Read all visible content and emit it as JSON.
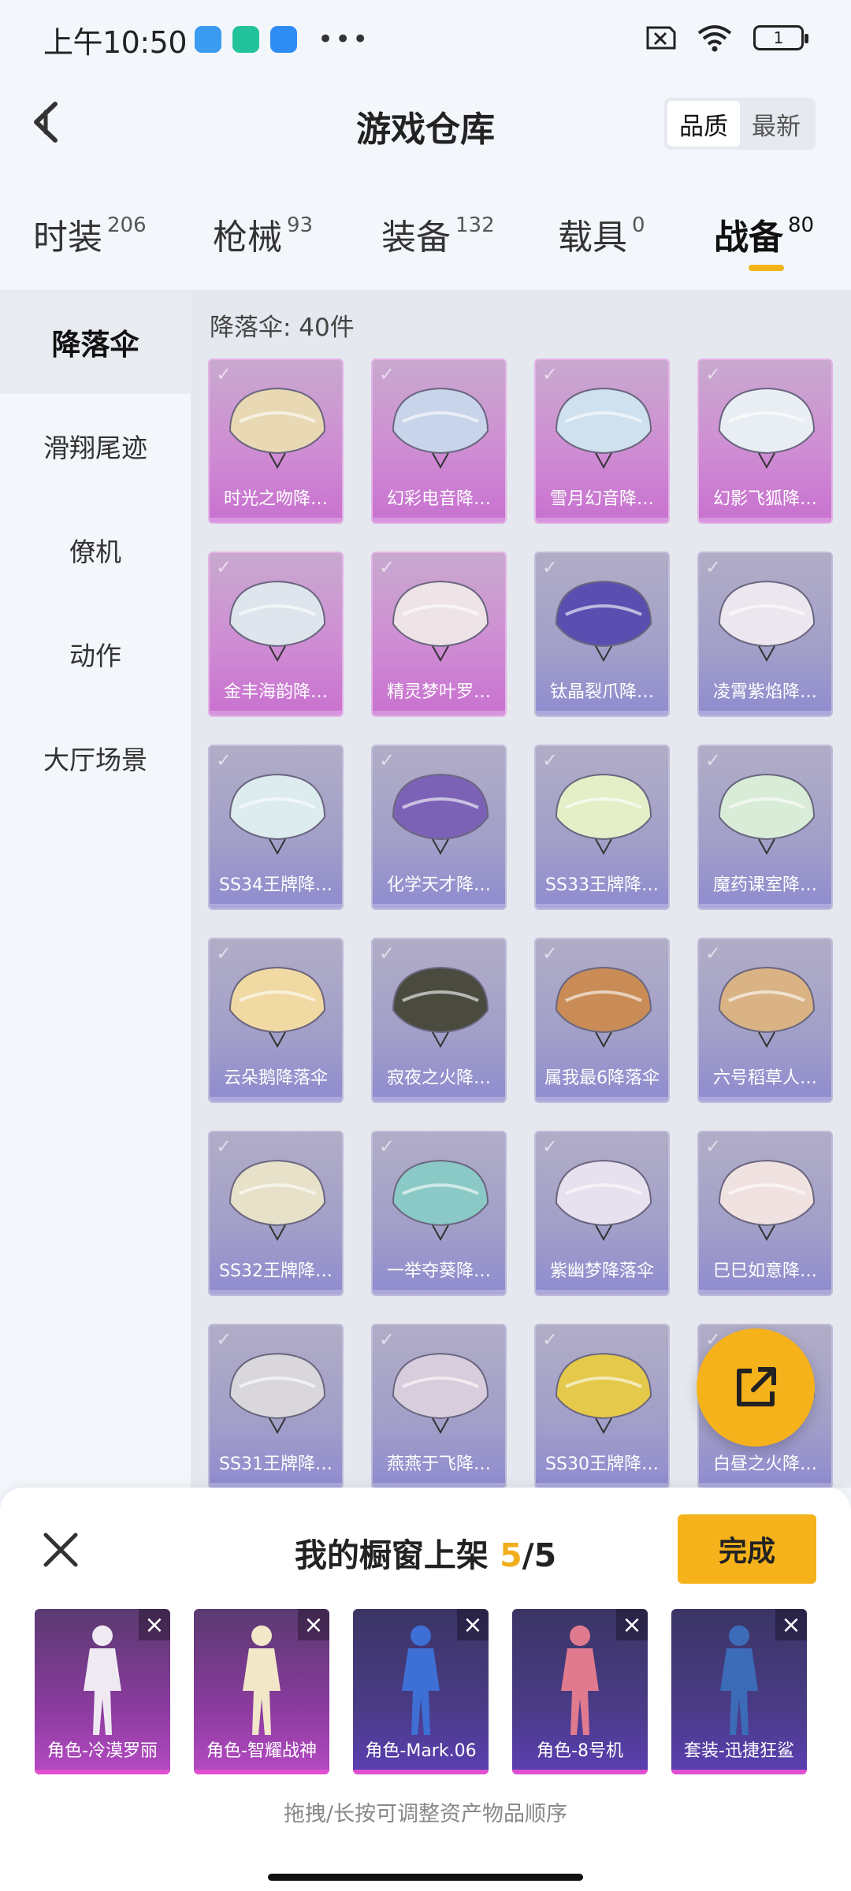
{
  "status_bar": {
    "time": "上午10:50",
    "battery": "1"
  },
  "header": {
    "title": "游戏仓库",
    "sort_options": [
      "品质",
      "最新"
    ],
    "active_sort": "品质"
  },
  "tabs": [
    {
      "label": "时装",
      "count": "206"
    },
    {
      "label": "枪械",
      "count": "93"
    },
    {
      "label": "装备",
      "count": "132"
    },
    {
      "label": "载具",
      "count": "0"
    },
    {
      "label": "战备",
      "count": "80",
      "active": true
    }
  ],
  "sidebar": {
    "items": [
      "降落伞",
      "滑翔尾迹",
      "僚机",
      "动作",
      "大厅场景"
    ],
    "active_index": 0
  },
  "section": {
    "title": "降落伞: 40件"
  },
  "items": [
    {
      "name": "时光之吻降…",
      "rarity": "purple",
      "color": "#e8d9b4"
    },
    {
      "name": "幻彩电音降…",
      "rarity": "purple",
      "color": "#c8d4ea"
    },
    {
      "name": "雪月幻音降…",
      "rarity": "purple",
      "color": "#cfe0ee"
    },
    {
      "name": "幻影飞狐降…",
      "rarity": "purple",
      "color": "#e8eef3"
    },
    {
      "name": "金丰海韵降…",
      "rarity": "purple",
      "color": "#dfe5ec"
    },
    {
      "name": "精灵梦叶罗…",
      "rarity": "purple",
      "color": "#eee4e8"
    },
    {
      "name": "钛晶裂爪降…",
      "rarity": "blue",
      "color": "#5a4fb0"
    },
    {
      "name": "凌霄紫焰降…",
      "rarity": "blue",
      "color": "#ece6ef"
    },
    {
      "name": "SS34王牌降…",
      "rarity": "blue",
      "color": "#dcecef"
    },
    {
      "name": "化学天才降…",
      "rarity": "blue",
      "color": "#7c62b6"
    },
    {
      "name": "SS33王牌降…",
      "rarity": "blue",
      "color": "#e4efc8"
    },
    {
      "name": "魔药课室降…",
      "rarity": "blue",
      "color": "#d8ecd8"
    },
    {
      "name": "云朵鹅降落伞",
      "rarity": "blue",
      "color": "#f1d9a4"
    },
    {
      "name": "寂夜之火降…",
      "rarity": "blue",
      "color": "#4a4a3f"
    },
    {
      "name": "属我最6降落伞",
      "rarity": "blue",
      "color": "#c98c56"
    },
    {
      "name": "六号稻草人…",
      "rarity": "blue",
      "color": "#d9b384"
    },
    {
      "name": "SS32王牌降…",
      "rarity": "blue",
      "color": "#e7e1c9"
    },
    {
      "name": "一举夺葵降…",
      "rarity": "blue",
      "color": "#8ac9c6"
    },
    {
      "name": "紫幽梦降落伞",
      "rarity": "blue",
      "color": "#e7e0ee"
    },
    {
      "name": "巳巳如意降…",
      "rarity": "blue",
      "color": "#f1e2e2"
    },
    {
      "name": "SS31王牌降…",
      "rarity": "blue",
      "color": "#d9d7dc"
    },
    {
      "name": "燕燕于飞降…",
      "rarity": "blue",
      "color": "#d7cddd"
    },
    {
      "name": "SS30王牌降…",
      "rarity": "blue",
      "color": "#e5c94b"
    },
    {
      "name": "白昼之火降…",
      "rarity": "blue",
      "color": "#f2c462"
    }
  ],
  "showcase": {
    "title_prefix": "我的橱窗上架",
    "current": "5",
    "separator": "/",
    "max": "5",
    "done_label": "完成",
    "hint": "拖拽/长按可调整资产物品顺序",
    "items": [
      {
        "name": "角色-冷漠罗丽",
        "rarity": "purple",
        "color": "#efe9f2"
      },
      {
        "name": "角色-智耀战神",
        "rarity": "purple",
        "color": "#f2e7c8"
      },
      {
        "name": "角色-Mark.06",
        "rarity": "blue",
        "color": "#3d6fd4"
      },
      {
        "name": "角色-8号机",
        "rarity": "blue",
        "color": "#e07a8e"
      },
      {
        "name": "套装-迅捷狂鲨",
        "rarity": "blue",
        "color": "#3c6bb8"
      }
    ]
  },
  "colors": {
    "accent": "#f6b21b",
    "purple_card": "#cf8dd3",
    "blue_card": "#a19fc8"
  }
}
